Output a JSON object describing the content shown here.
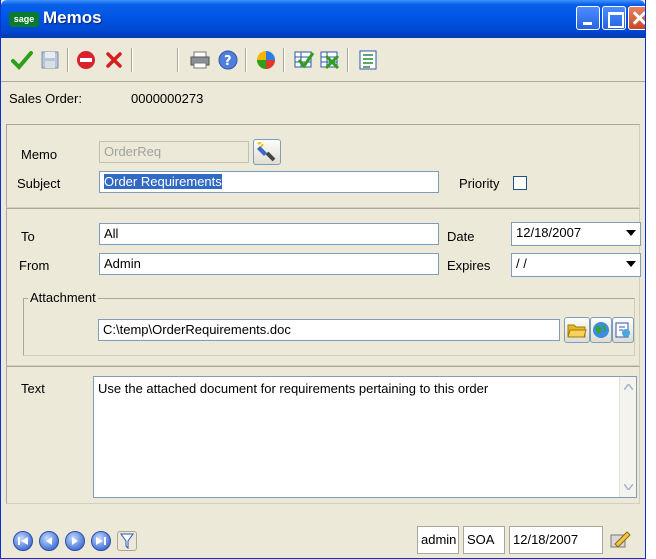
{
  "window": {
    "title": "Memos",
    "logo_text": "sage"
  },
  "toolbar": {
    "icons": [
      "accept-icon",
      "save-icon",
      "stop-icon",
      "delete-icon",
      "print-icon",
      "help-icon",
      "palette-icon",
      "table-accept-icon",
      "table-delete-icon",
      "memo-list-icon"
    ]
  },
  "header": {
    "sales_order_label": "Sales Order:",
    "sales_order_value": "0000000273"
  },
  "memo": {
    "memo_label": "Memo",
    "memo_value": "OrderReq",
    "subject_label": "Subject",
    "subject_value": "Order Requirements",
    "priority_label": "Priority",
    "priority_checked": false
  },
  "routing": {
    "to_label": "To",
    "to_value": "All",
    "from_label": "From",
    "from_value": "Admin",
    "date_label": "Date",
    "date_value": "12/18/2007",
    "expires_label": "Expires",
    "expires_value": " /  /"
  },
  "attachment": {
    "legend": "Attachment",
    "path": "C:\\temp\\OrderRequirements.doc"
  },
  "text": {
    "label": "Text",
    "value": "Use the attached document for requirements pertaining to this order"
  },
  "statusbar": {
    "user": "admin",
    "company": "SOA",
    "date": "12/18/2007"
  },
  "colors": {
    "title_bar": "#0055e5",
    "window_bg": "#ece9d8",
    "selection": "#316ac5",
    "field_border": "#7f9db9"
  }
}
